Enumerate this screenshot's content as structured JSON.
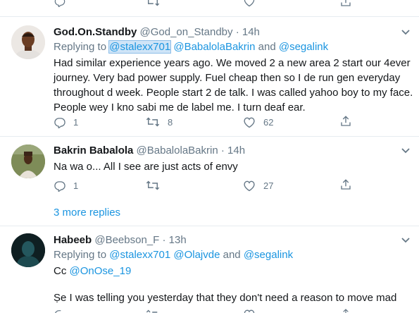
{
  "tweets": [
    {
      "name": "God.On.Standby",
      "handle": "@God_on_Standby",
      "dot": "·",
      "time": "14h",
      "replying_label": "Replying to",
      "mentions": [
        "@stalexx701",
        "@BabalolaBakrin",
        "@segalink"
      ],
      "and": "and",
      "lines": [
        "Had similar experience years ago. We moved 2 a new area 2 start our 4ever",
        "journey. Very bad power supply. Fuel cheap then so I de run gen everyday",
        "throughout d week. People start 2 de talk. I was called yahoo boy to my face.",
        "People wey I kno sabi me de label me. I turn deaf ear."
      ],
      "reply_count": "1",
      "retweet_count": "8",
      "like_count": "62"
    },
    {
      "name": "Bakrin Babalola",
      "handle": "@BabalolaBakrin",
      "dot": "·",
      "time": "14h",
      "text": "Na wa o... All I see are just acts of envy",
      "reply_count": "1",
      "retweet_count": "",
      "like_count": "27"
    },
    {
      "name": "Habeeb",
      "handle": "@Beebson_F",
      "dot": "·",
      "time": "13h",
      "replying_label": "Replying to",
      "mentions": [
        "@stalexx701",
        "@Olajvde",
        "@segalink"
      ],
      "and": "and",
      "cc_label": "Cc",
      "cc_mention": "@OnOse_19",
      "text": "Ṣe I was telling you yesterday that they don't need a reason to move mad"
    }
  ],
  "more_replies": "3 more replies",
  "colors": {
    "link": "#1b95e0",
    "secondary_text": "#657786",
    "divider": "#e6ecf0"
  }
}
